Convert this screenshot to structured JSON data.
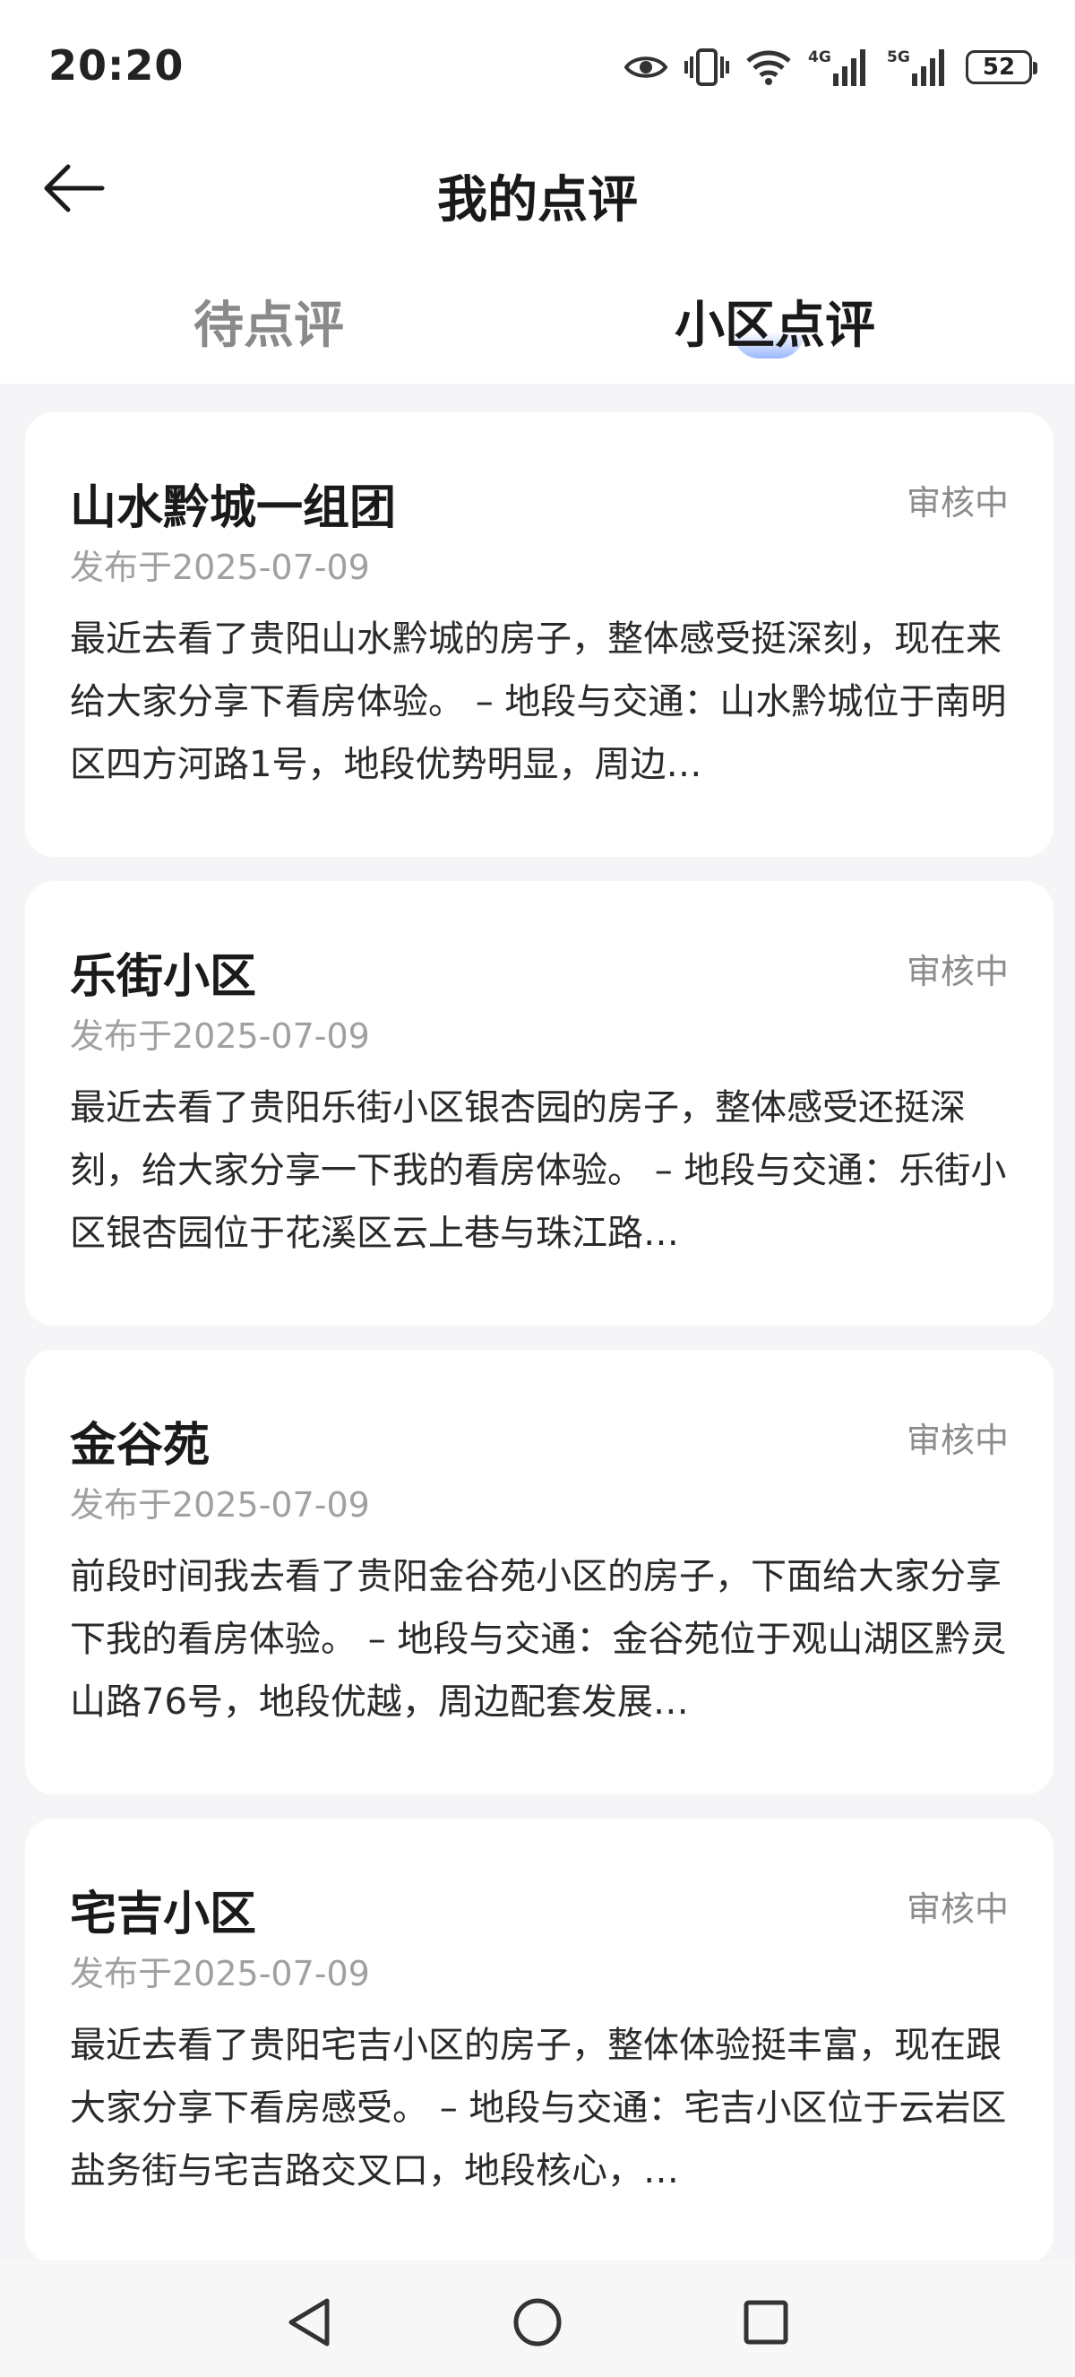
{
  "status_bar": {
    "time": "20:20",
    "battery": "52",
    "icons": [
      "eye-icon",
      "vibrate-icon",
      "wifi-icon",
      "4g-signal-icon",
      "5g-signal-icon",
      "battery-icon"
    ],
    "network_4g": "4G",
    "network_5g": "5G"
  },
  "app_bar": {
    "title": "我的点评",
    "back_icon": "arrow-left-icon"
  },
  "tabs": [
    {
      "label": "待点评",
      "active": false
    },
    {
      "label": "小区点评",
      "active": true
    }
  ],
  "accent_color": "#7aa2ff",
  "reviews": [
    {
      "title": "山水黔城一组团",
      "status": "审核中",
      "date": "发布于2025-07-09",
      "excerpt": "最近去看了贵阳山水黔城的房子，整体感受挺深刻，现在来给大家分享下看房体验。 – 地段与交通：山水黔城位于南明区四方河路1号，地段优势明显，周边…"
    },
    {
      "title": "乐街小区",
      "status": "审核中",
      "date": "发布于2025-07-09",
      "excerpt": "最近去看了贵阳乐街小区银杏园的房子，整体感受还挺深刻，给大家分享一下我的看房体验。  – 地段与交通：乐街小区银杏园位于花溪区云上巷与珠江路…"
    },
    {
      "title": "金谷苑",
      "status": "审核中",
      "date": "发布于2025-07-09",
      "excerpt": "前段时间我去看了贵阳金谷苑小区的房子，下面给大家分享下我的看房体验。 – 地段与交通：金谷苑位于观山湖区黔灵山路76号，地段优越，周边配套发展…"
    },
    {
      "title": "宅吉小区",
      "status": "审核中",
      "date": "发布于2025-07-09",
      "excerpt": "最近去看了贵阳宅吉小区的房子，整体体验挺丰富，现在跟大家分享下看房感受。 – 地段与交通：宅吉小区位于云岩区盐务街与宅吉路交叉口，地段核心，…"
    }
  ],
  "nav_bar": {
    "icons": [
      "triangle-back-icon",
      "circle-home-icon",
      "square-recent-icon"
    ]
  }
}
